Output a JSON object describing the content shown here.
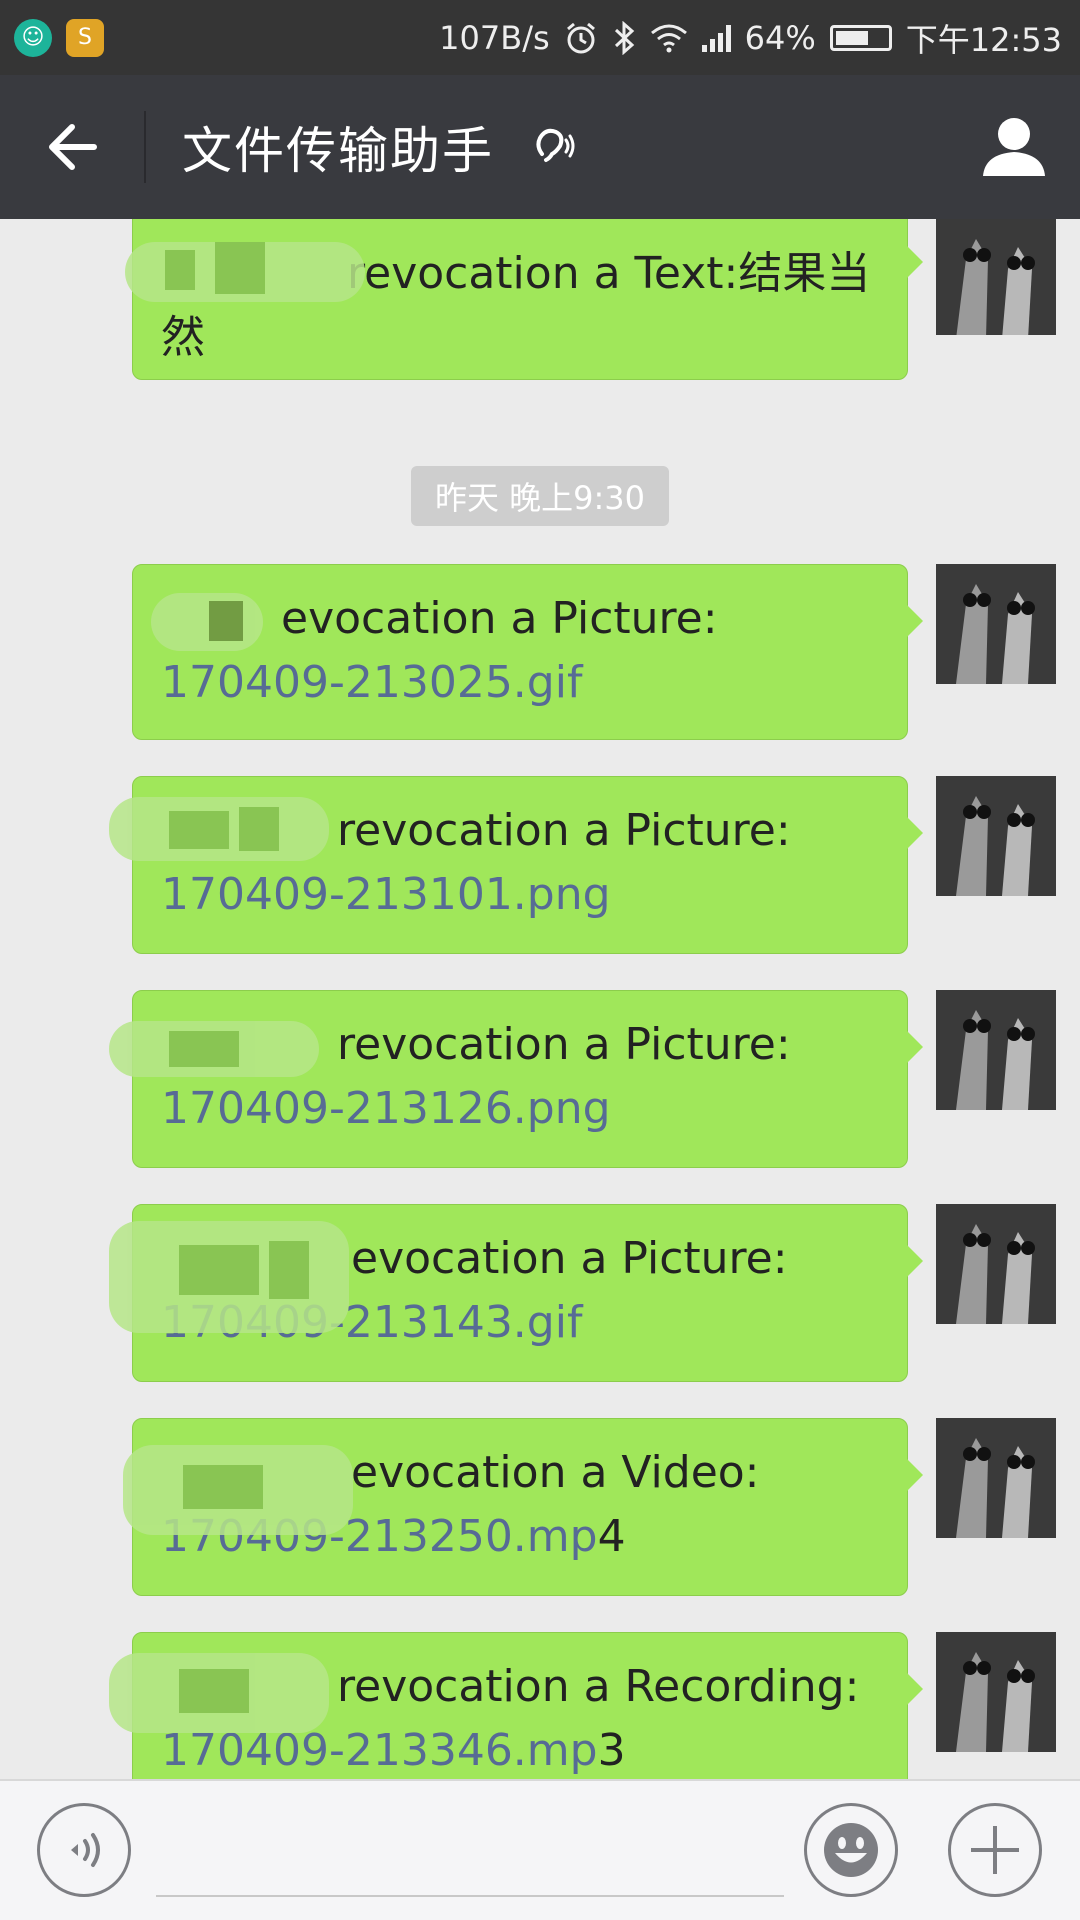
{
  "status_bar": {
    "speed": "107B/s",
    "battery": "64%",
    "battery_level": 0.64,
    "time": "下午12:53",
    "icons": [
      "notification-icon",
      "app-icon",
      "alarm-icon",
      "bluetooth-icon",
      "wifi-icon",
      "signal-icon",
      "battery-icon"
    ]
  },
  "header": {
    "title": "文件传输助手",
    "back_icon": "arrow-left-icon",
    "mode_icon": "ear-icon",
    "profile_icon": "person-icon"
  },
  "chat": {
    "timestamp": "昨天 晚上9:30",
    "messages": [
      {
        "text": "revocation a Text:结果当然",
        "line1": "revocation a Text:结果当",
        "line2": "然",
        "file": ""
      },
      {
        "line1": "evocation a Picture:",
        "file": "170409-213025.gif",
        "suffix": ""
      },
      {
        "line1": "revocation a Picture:",
        "file": "170409-213101.png",
        "suffix": ""
      },
      {
        "line1": "revocation a Picture:",
        "file": "170409-213126.png",
        "suffix": ""
      },
      {
        "line1": "evocation a Picture:",
        "file": "170409-213143.gif",
        "suffix": ""
      },
      {
        "line1": "evocation a Video:",
        "file": "170409-213250.mp",
        "suffix": "4"
      },
      {
        "line1": "revocation a Recording:",
        "file": "170409-213346.mp",
        "suffix": "3"
      }
    ]
  },
  "input_bar": {
    "voice_icon": "voice-icon",
    "emoji_icon": "emoji-icon",
    "plus_icon": "plus-icon",
    "placeholder": ""
  },
  "colors": {
    "bubble": "#a0e75a",
    "link": "#576b95",
    "nav": "#393a3f",
    "status": "#353535"
  }
}
